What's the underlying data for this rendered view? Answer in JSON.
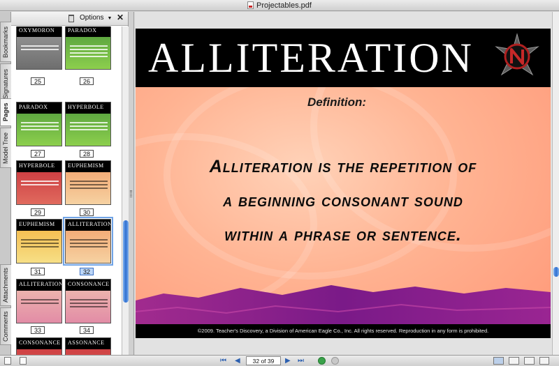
{
  "window": {
    "title": "Projectables.pdf"
  },
  "side_tabs": [
    "Bookmarks",
    "Signatures",
    "Pages",
    "Model Tree",
    "Attachments",
    "Comments"
  ],
  "side_tab_active": "Pages",
  "panel": {
    "options_label": "Options"
  },
  "thumbnails": [
    {
      "title": "Oxymoron",
      "page": "25",
      "color": "gray"
    },
    {
      "title": "Paradox",
      "page": "26",
      "color": "green"
    },
    {
      "title": "Paradox",
      "page": "27",
      "color": "green"
    },
    {
      "title": "Hyperbole",
      "page": "28",
      "color": "green"
    },
    {
      "title": "Hyperbole",
      "page": "29",
      "color": "red"
    },
    {
      "title": "Euphemism",
      "page": "30",
      "color": "orange"
    },
    {
      "title": "Euphemism",
      "page": "31",
      "color": "yellow"
    },
    {
      "title": "Alliteration",
      "page": "32",
      "color": "orange",
      "selected": true
    },
    {
      "title": "Alliteration",
      "page": "33",
      "color": "pink"
    },
    {
      "title": "Consonance",
      "page": "34",
      "color": "pink"
    },
    {
      "title": "Consonance",
      "page": "",
      "color": "red"
    },
    {
      "title": "Assonance",
      "page": "",
      "color": "red"
    }
  ],
  "slide": {
    "title": "Alliteration",
    "definition_label": "Definition:",
    "definition_lines": [
      "Alliteration is the repetition of",
      "a beginning consonant sound",
      "within a phrase or sentence."
    ],
    "footer": "©2009. Teacher's Discovery, a Division of American Eagle Co., Inc. All rights reserved. Reproduction in any form is prohibited."
  },
  "navigation": {
    "page_field": "32 of 39"
  },
  "colors": {
    "title_band": "#000000",
    "slide_bg": "#ffb392",
    "purple_band": "#8a1f8c",
    "selection": "#6fa3e6"
  }
}
